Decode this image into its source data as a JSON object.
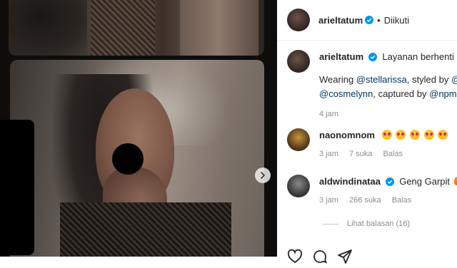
{
  "post": {
    "username": "arieltatum",
    "follow_status": "Diikuti",
    "caption_preview": "Layanan berhenti mer",
    "caption_line2": {
      "prefix": "Wearing ",
      "mention1": "@stellarissa",
      "middle": ", styled by ",
      "mention2": "@in"
    },
    "caption_line3": {
      "mention3": "@cosmelynn",
      "middle": ", captured by ",
      "mention4": "@npmali"
    },
    "caption_time": "4 jam"
  },
  "comments": [
    {
      "username": "naonomnom",
      "time": "3 jam",
      "likes": "7 suka",
      "reply_label": "Balas"
    },
    {
      "username": "aldwindinataa",
      "text": "Geng Garpit",
      "time": "3 jam",
      "likes": "266 suka",
      "reply_label": "Balas"
    }
  ],
  "view_replies": "Lihat balasan (16)",
  "colors": {
    "verified_blue": "#0095f6",
    "link_blue": "#00376b",
    "meta_gray": "#8e8e8e"
  }
}
